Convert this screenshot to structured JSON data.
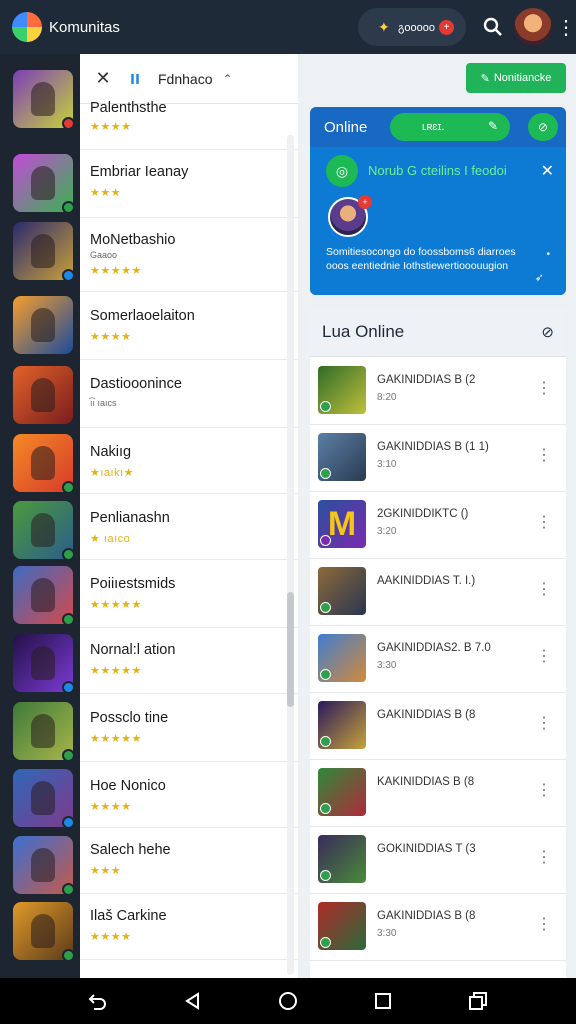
{
  "app": {
    "title": "Komunitas",
    "coin_text": "გooooo",
    "notif_count": "+",
    "search_icon": "search-icon",
    "menu_icon": "kebab-menu-icon"
  },
  "list_header": {
    "title": "Fdnhaco",
    "bars_glyph": "ıı",
    "close_glyph": "✕",
    "arrow_glyph": "⌃"
  },
  "list_items": [
    {
      "name": "Palenthsthe",
      "sub": "",
      "stars": "★★★★"
    },
    {
      "name": "Embriar Ieanay",
      "sub": "",
      "stars": "★★★"
    },
    {
      "name": "MoNetbashio",
      "sub": "Gaaoo",
      "stars": "★★★★★"
    },
    {
      "name": "Somerlaoelaiton",
      "sub": "",
      "stars": "★★★★"
    },
    {
      "name": "Dastiooonince",
      "sub": "ı͡ı ıaıcs",
      "stars": ""
    },
    {
      "name": "Nakiıg",
      "sub": "",
      "stars": "★ıaıkı★"
    },
    {
      "name": "Penlianashn",
      "sub": "",
      "stars": "★ ıaıco"
    },
    {
      "name": "Poiiıestsmids",
      "sub": "",
      "stars": "★★★★★"
    },
    {
      "name": "Nornal:l ation",
      "sub": "",
      "stars": "★★★★★"
    },
    {
      "name": "Possclo tine",
      "sub": "",
      "stars": "★★★★★"
    },
    {
      "name": "Hoe Nonico",
      "sub": "",
      "stars": "★★★★"
    },
    {
      "name": "Salech hehe",
      "sub": "",
      "stars": "★★★"
    },
    {
      "name": "Ilaš Carkine",
      "sub": "",
      "stars": "★★★★"
    }
  ],
  "new_button": {
    "label": "Nonitiancke"
  },
  "online_card": {
    "label": "Online",
    "pill_text": "ʟʀɛɪ.",
    "notice": "Norub G cteilins I feodoi",
    "body_text": "Somitiesocongo do foossboms6 diarroes ooos eentiednie Iothstiewertiooouugion",
    "avatar_badge": "+"
  },
  "lua_online": {
    "title": "Lua Online",
    "items": [
      {
        "name": "GAKINIDDIAS B (2",
        "sub": "8:20"
      },
      {
        "name": "GAKINIDDIAS B (1 1)",
        "sub": "3:10"
      },
      {
        "name": "2GKINIDDIKTC ()",
        "sub": "3:20"
      },
      {
        "name": "AAKINIDDIAS T. I.)",
        "sub": ""
      },
      {
        "name": "GAKINIDDIAS2. B 7.0",
        "sub": "3:30"
      },
      {
        "name": "GAKINIDDIAS B (8",
        "sub": ""
      },
      {
        "name": "KAKINIDDIAS B (8",
        "sub": ""
      },
      {
        "name": "GOKINIDDIAS T (3",
        "sub": ""
      },
      {
        "name": "GAKINIDDIAS B (8",
        "sub": "3:30"
      }
    ]
  }
}
